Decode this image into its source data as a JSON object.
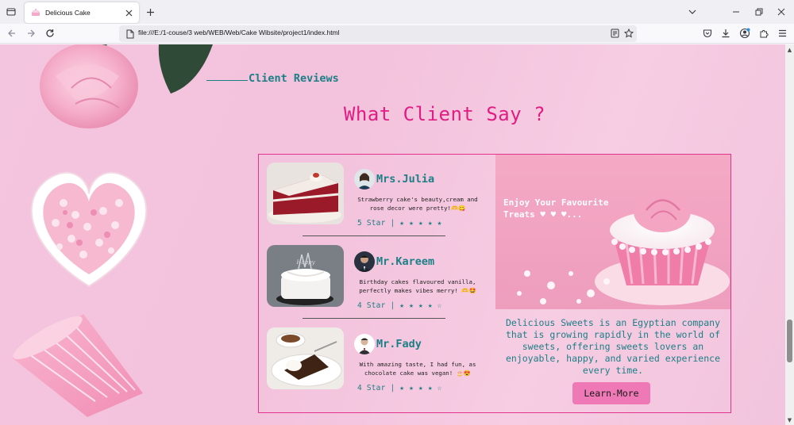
{
  "browser": {
    "tab_title": "Delicious Cake",
    "url": "file:///E:/1-couse/3 web/WEB/Web/Cake Wibsite/project1/index.html",
    "icons": [
      "tab-list-icon",
      "cake-favicon",
      "close-icon",
      "plus-icon",
      "chevron-down-icon",
      "minimize-icon",
      "restore-icon",
      "close-window-icon",
      "back-arrow-icon",
      "forward-arrow-icon",
      "reload-icon",
      "page-icon",
      "reader-view-icon",
      "bookmark-star-icon",
      "pocket-icon",
      "download-icon",
      "account-icon",
      "extensions-icon",
      "menu-icon"
    ]
  },
  "section": {
    "tag": "Client Reviews",
    "heading": "What Client Say ?"
  },
  "reviews": [
    {
      "name": "Mrs.Julia",
      "text": "Strawberry cake's beauty,cream and rose decor were pretty!🫶😋",
      "rating_label": "5 Star",
      "stars": "★ ★ ★ ★ ★",
      "rating": 5
    },
    {
      "name": "Mr.Kareem",
      "text": "Birthday cakes flavoured vanilla, perfectly makes vibes merry! 🫶🤩",
      "rating_label": "4 Star",
      "stars": "★ ★ ★ ★ ☆",
      "rating": 4
    },
    {
      "name": "Mr.Fady",
      "text": "With amazing taste, I had fun, as chocolate cake was vegan! 🎂😍",
      "rating_label": "4 Star",
      "stars": "★ ★ ★ ★ ☆",
      "rating": 4
    }
  ],
  "promo": {
    "caption": "Enjoy Your Favourite Treats ♥ ♥ ♥...",
    "text": "Delicious Sweets is an Egyptian company that is growing rapidly in the world of sweets, offering sweets lovers an enjoyable, happy, and varied experience every time.",
    "button": "Learn-More"
  },
  "colors": {
    "accent_teal": "#1b7f86",
    "heading_pink": "#e11d84",
    "border_pink": "#e2348f",
    "button_pink": "#ef78b6"
  }
}
